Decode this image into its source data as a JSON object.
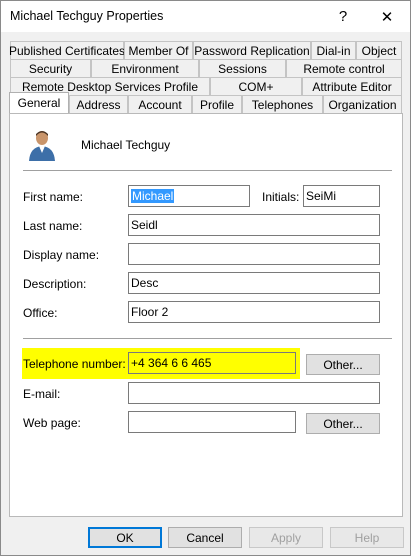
{
  "window": {
    "title": "Michael Techguy Properties"
  },
  "titlebar": {
    "help_glyph": "?",
    "close_glyph": "✕"
  },
  "tabs": {
    "row1": [
      "Published Certificates",
      "Member Of",
      "Password Replication",
      "Dial-in",
      "Object"
    ],
    "row2": [
      "Security",
      "Environment",
      "Sessions",
      "Remote control"
    ],
    "row3": [
      "Remote Desktop Services Profile",
      "COM+",
      "Attribute Editor"
    ],
    "row4": [
      "General",
      "Address",
      "Account",
      "Profile",
      "Telephones",
      "Organization"
    ],
    "active": "General"
  },
  "general": {
    "display_name_header": "Michael Techguy",
    "first_name_label": "First name:",
    "first_name_value": "Michael",
    "initials_label": "Initials:",
    "initials_value": "SeiMi",
    "last_name_label": "Last name:",
    "last_name_value": "Seidl",
    "display_name_label": "Display name:",
    "display_name_value": "",
    "description_label": "Description:",
    "description_value": "Desc",
    "office_label": "Office:",
    "office_value": "Floor 2",
    "telephone_label": "Telephone number:",
    "telephone_value": "+4 364 6 6 465",
    "telephone_other": "Other...",
    "email_label": "E-mail:",
    "email_value": "",
    "webpage_label": "Web page:",
    "webpage_value": "",
    "webpage_other": "Other..."
  },
  "footer": {
    "ok": "OK",
    "cancel": "Cancel",
    "apply": "Apply",
    "help": "Help"
  },
  "colors": {
    "highlight": "#ffff00",
    "selection": "#3399ff",
    "accent": "#0078d7"
  }
}
